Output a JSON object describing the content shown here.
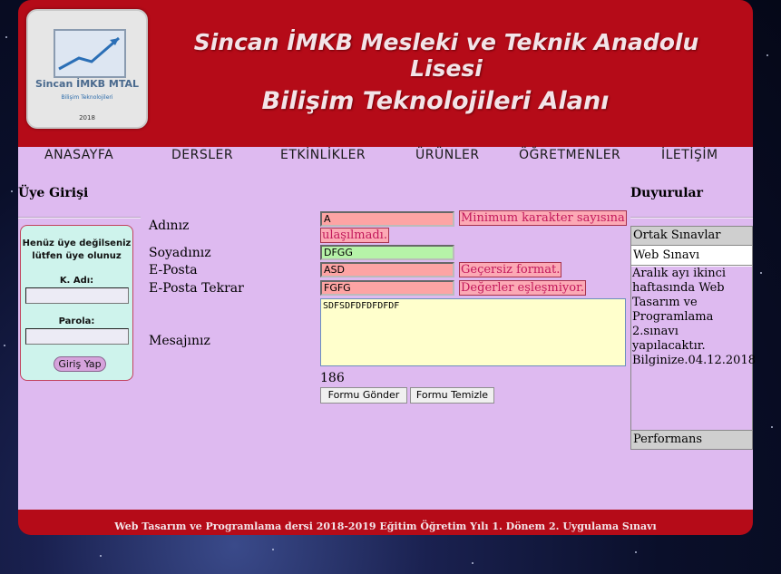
{
  "header": {
    "title": "Sincan İMKB Mesleki ve Teknik Anadolu Lisesi",
    "subtitle": "Bilişim Teknolojileri Alanı",
    "logo": {
      "name": "Sincan İMKB MTAL",
      "tagline": "Bilişim Teknolojileri",
      "year": "2018"
    }
  },
  "nav": [
    "ANASAYFA",
    "DERSLER",
    "ETKİNLİKLER",
    "ÜRÜNLER",
    "ÖĞRETMENLER",
    "İLETİŞİM"
  ],
  "login": {
    "heading": "Üye Girişi",
    "note_line1": "Henüz üye değilseniz",
    "note_line2": "lütfen üye olunuz",
    "username_label": "K. Adı:",
    "password_label": "Parola:",
    "button": "Giriş Yap"
  },
  "form": {
    "name_label": "Adınız",
    "surname_label": "Soyadınız",
    "email_label": "E-Posta",
    "email_repeat_label": "E-Posta Tekrar",
    "message_label": "Mesajınız",
    "name_value": "A",
    "surname_value": "DFGG",
    "email_value": "ASD",
    "email_repeat_value": "FGFG",
    "message_value": "SDFSDFDFDFDFDF",
    "name_error_line1": "Minimum karakter sayısına",
    "name_error_line2": "ulaşılmadı.",
    "email_error": "Geçersiz format.",
    "email_repeat_error": "Değerler eşleşmiyor.",
    "char_counter": "186",
    "submit_button": "Formu  Gönder",
    "clear_button": "Formu Temizle"
  },
  "announcements": {
    "heading": "Duyurular",
    "tabs": [
      "Ortak Sınavlar",
      "Web Sınavı",
      "Performans"
    ],
    "body": "Aralık ayı ikinci haftasında Web Tasarım ve Programlama 2.sınavı yapılacaktır. Bilginize.04.12.2018"
  },
  "footer": "Web Tasarım ve Programlama dersi 2018-2019 Eğitim Öğretim Yılı 1. Dönem 2. Uygulama Sınavı",
  "colors": {
    "header_bg": "#b50b18",
    "content_bg": "#debaf0",
    "error_bg": "#fda4a4",
    "ok_bg": "#b6f3a8",
    "textarea_bg": "#ffffcc"
  }
}
